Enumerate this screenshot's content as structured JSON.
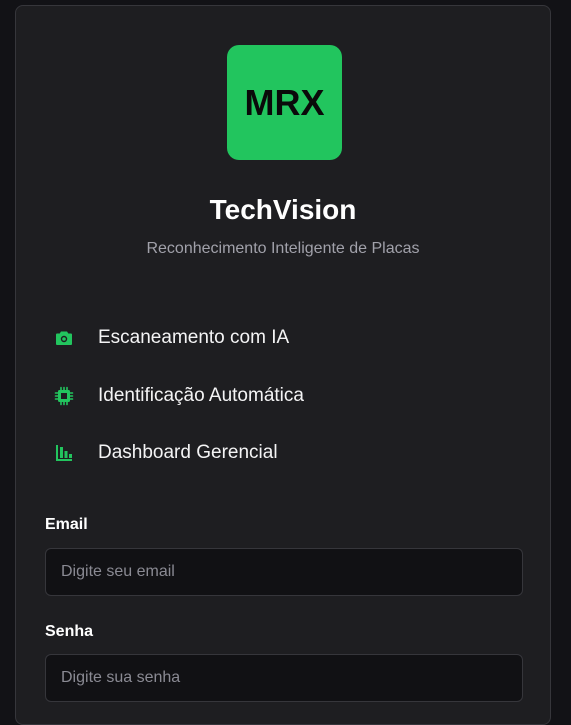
{
  "brand": {
    "logo_text": "MRX",
    "title": "TechVision",
    "subtitle": "Reconhecimento Inteligente de Placas",
    "accent_color": "#22c55e"
  },
  "features": [
    {
      "icon": "camera-icon",
      "label": "Escaneamento com IA"
    },
    {
      "icon": "chip-icon",
      "label": "Identificação Automática"
    },
    {
      "icon": "bar-chart-icon",
      "label": "Dashboard Gerencial"
    }
  ],
  "form": {
    "email": {
      "label": "Email",
      "value": "",
      "placeholder": "Digite seu email"
    },
    "password": {
      "label": "Senha",
      "value": "",
      "placeholder": "Digite sua senha"
    }
  }
}
